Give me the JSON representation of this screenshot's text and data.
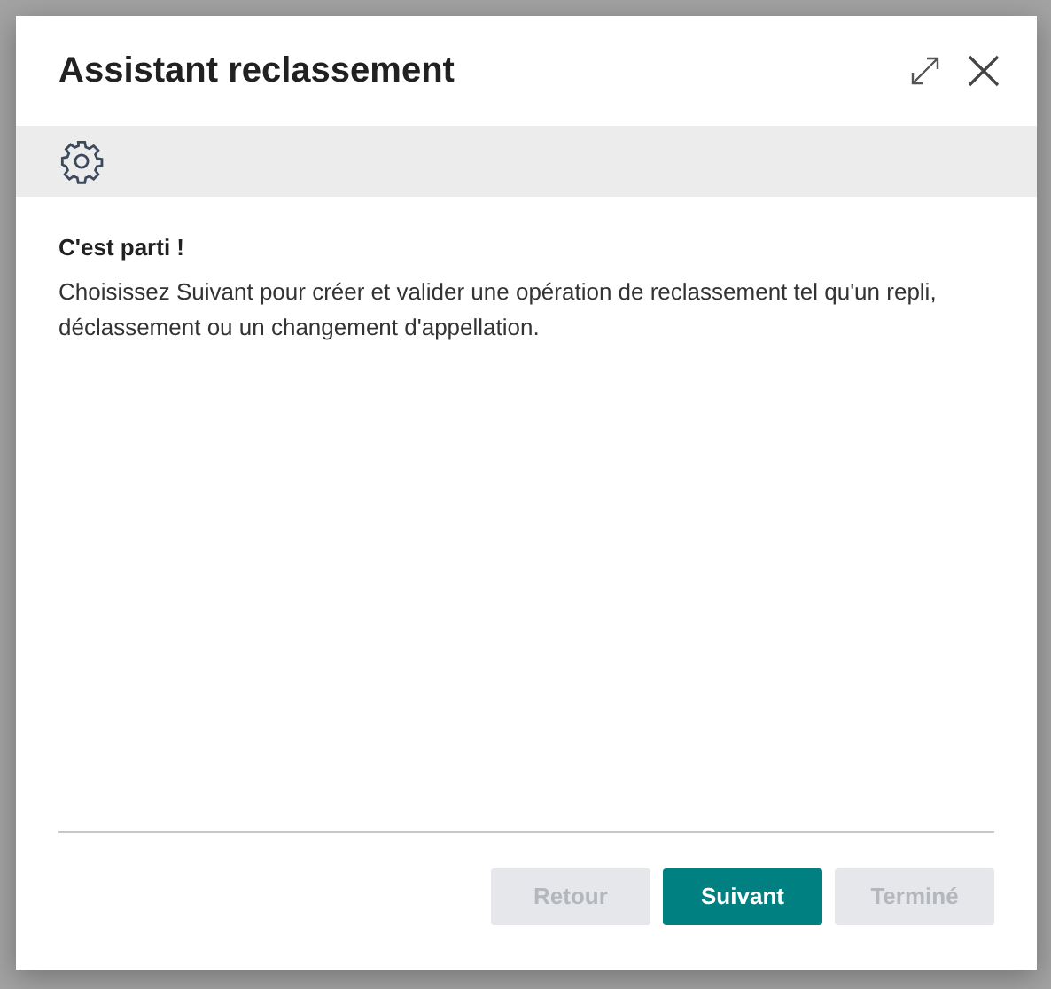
{
  "dialog": {
    "title": "Assistant reclassement",
    "heading": "C'est parti !",
    "body": "Choisissez Suivant pour créer et valider une opération de reclassement tel qu'un repli, déclassement ou un changement d'appellation.",
    "buttons": [
      {
        "label": "Retour",
        "kind": "secondary",
        "disabled": true
      },
      {
        "label": "Suivant",
        "kind": "primary",
        "disabled": false
      },
      {
        "label": "Terminé",
        "kind": "secondary",
        "disabled": true
      }
    ]
  }
}
